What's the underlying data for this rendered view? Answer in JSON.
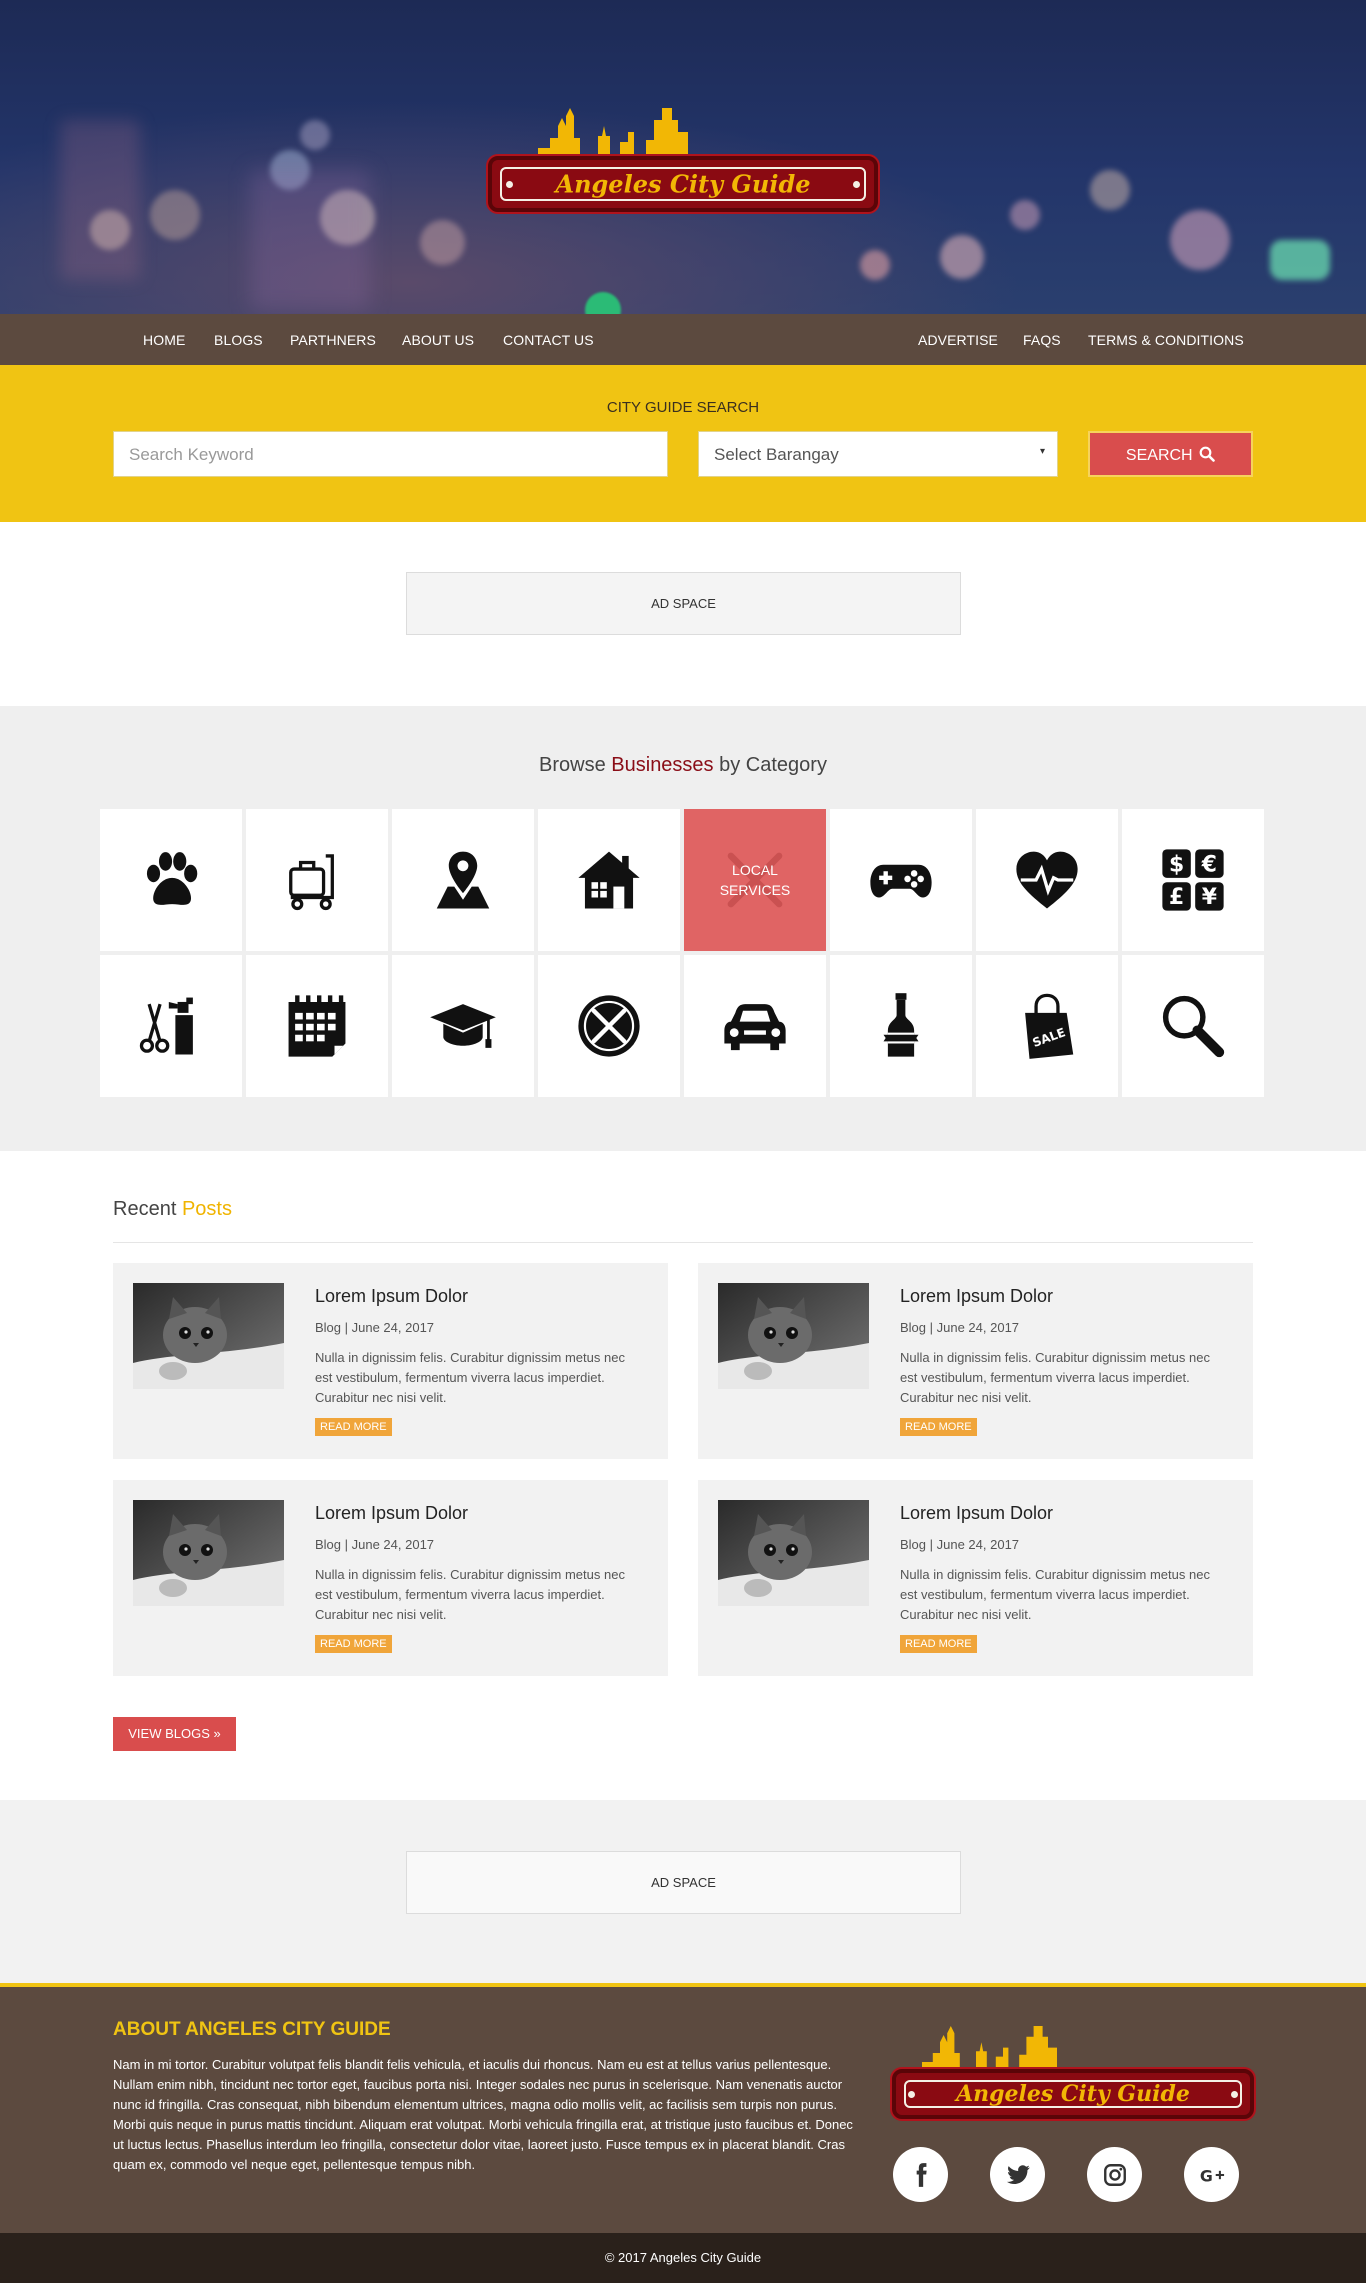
{
  "brand": {
    "name": "Angeles City Guide",
    "colors": {
      "primary_red": "#d94d4d",
      "gold": "#f0c413",
      "brown": "#5c4a3f",
      "dark_red": "#8a0d17"
    }
  },
  "nav": {
    "left": [
      "HOME",
      "BLOGS",
      "PARTHNERS",
      "ABOUT US",
      "CONTACT US"
    ],
    "right": [
      "ADVERTISE",
      "FAQS",
      "TERMS & CONDITIONS"
    ]
  },
  "search": {
    "title": "CITY GUIDE SEARCH",
    "keyword_placeholder": "Search Keyword",
    "barangay_selected": "Select Barangay",
    "button_label": "SEARCH",
    "button_icon": "search-icon"
  },
  "ads": {
    "top": "AD SPACE",
    "bottom": "AD SPACE"
  },
  "categories": {
    "title_pre": "Browse ",
    "title_hl": "Businesses",
    "title_post": " by Category",
    "active_label_1": "LOCAL",
    "active_label_2": "SERVICES",
    "icons": [
      "paw-icon",
      "luggage-cart-icon",
      "map-pin-icon",
      "house-icon",
      "local-services-icon",
      "gamepad-icon",
      "heartbeat-icon",
      "currency-icon",
      "grooming-icon",
      "calendar-icon",
      "graduation-cap-icon",
      "dining-icon",
      "car-icon",
      "bottle-icon",
      "shopping-bag-icon",
      "magnifier-icon"
    ]
  },
  "recent": {
    "title_pre": "Recent ",
    "title_hl": "Posts",
    "posts": [
      {
        "title": "Lorem Ipsum Dolor",
        "meta": "Blog | June 24, 2017",
        "excerpt": "Nulla in dignissim felis. Curabitur dignissim metus nec est vestibulum, fermentum viverra lacus imperdiet. Curabitur nec nisi velit.",
        "cta": "READ MORE"
      },
      {
        "title": "Lorem Ipsum Dolor",
        "meta": "Blog | June 24, 2017",
        "excerpt": "Nulla in dignissim felis. Curabitur dignissim metus nec est vestibulum, fermentum viverra lacus imperdiet. Curabitur nec nisi velit.",
        "cta": "READ MORE"
      },
      {
        "title": "Lorem Ipsum Dolor",
        "meta": "Blog | June 24, 2017",
        "excerpt": "Nulla in dignissim felis. Curabitur dignissim metus nec est vestibulum, fermentum viverra lacus imperdiet. Curabitur nec nisi velit.",
        "cta": "READ MORE"
      },
      {
        "title": "Lorem Ipsum Dolor",
        "meta": "Blog | June 24, 2017",
        "excerpt": "Nulla in dignissim felis. Curabitur dignissim metus nec est vestibulum, fermentum viverra lacus imperdiet. Curabitur nec nisi velit.",
        "cta": "READ MORE"
      }
    ],
    "view_all": "VIEW BLOGS »"
  },
  "footer": {
    "about_title": "ABOUT ANGELES CITY GUIDE",
    "about_text": "Nam in mi tortor. Curabitur volutpat felis blandit felis vehicula, et iaculis dui rhoncus. Nam eu est at tellus varius pellentesque. Nullam enim nibh, tincidunt nec tortor eget, faucibus porta nisi. Integer sodales nec purus in scelerisque. Nam venenatis auctor nunc id fringilla. Cras consequat, nibh bibendum elementum ultrices, magna odio mollis velit, ac facilisis sem turpis non purus. Morbi quis neque in purus mattis tincidunt. Aliquam erat volutpat. Morbi vehicula fringilla erat, at tristique justo faucibus et. Donec ut luctus lectus. Phasellus interdum leo fringilla, consectetur dolor vitae, laoreet justo. Fusce tempus ex in placerat blandit. Cras quam ex, commodo vel neque eget, pellentesque tempus nibh.",
    "social": [
      "facebook-icon",
      "twitter-icon",
      "instagram-icon",
      "google-plus-icon"
    ],
    "copyright": "© 2017 Angeles City Guide"
  }
}
